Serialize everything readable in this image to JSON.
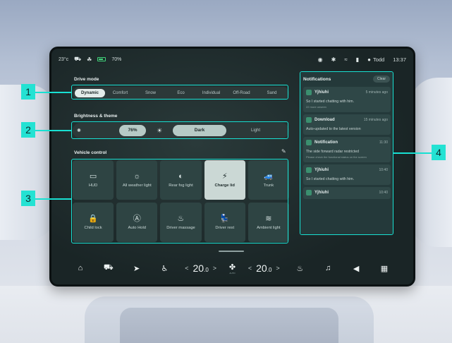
{
  "status_bar": {
    "temperature": "23°c",
    "battery_pct": "70%",
    "user_name": "Todd",
    "time": "13:37"
  },
  "drive_mode": {
    "title": "Drive mode",
    "modes": [
      "Dynamic",
      "Comfort",
      "Snow",
      "Eco",
      "Individual",
      "Off-Road",
      "Sand"
    ],
    "active": "Dynamic"
  },
  "brightness": {
    "title": "Brightness & theme",
    "value": "76%",
    "theme_dark": "Dark",
    "theme_light": "Light",
    "active_theme": "Dark"
  },
  "vehicle_control": {
    "title": "Vehicle control",
    "tiles": [
      {
        "label": "HUD",
        "icon": "hud-icon",
        "glyph": "▭",
        "active": false
      },
      {
        "label": "All weather light",
        "icon": "all-weather-light-icon",
        "glyph": "☼",
        "active": false
      },
      {
        "label": "Rear fog light",
        "icon": "rear-fog-light-icon",
        "glyph": "◐",
        "active": false
      },
      {
        "label": "Charge lid",
        "icon": "charge-lid-icon",
        "glyph": "⚡",
        "active": true
      },
      {
        "label": "Trunk",
        "icon": "trunk-icon",
        "glyph": "🚙",
        "active": false
      },
      {
        "label": "Child lock",
        "icon": "child-lock-icon",
        "glyph": "🔒",
        "active": false
      },
      {
        "label": "Auto Hold",
        "icon": "auto-hold-icon",
        "glyph": "Ⓐ",
        "active": false
      },
      {
        "label": "Driver massage",
        "icon": "driver-massage-icon",
        "glyph": "♨",
        "active": false
      },
      {
        "label": "Driver rest",
        "icon": "driver-rest-icon",
        "glyph": "💺",
        "active": false
      },
      {
        "label": "Ambient light",
        "icon": "ambient-light-icon",
        "glyph": "≋",
        "active": false
      }
    ]
  },
  "notifications": {
    "title": "Notifications",
    "clear_label": "Clear",
    "items": [
      {
        "app": "Yjhiuhi",
        "time": "5 minutes ago",
        "body": "So I started chatting with him.",
        "sub": "22 more unseen"
      },
      {
        "app": "Download",
        "time": "15 minutes ago",
        "body": "Auto-updated to the latest version",
        "sub": ""
      },
      {
        "app": "Notification",
        "time": "11:30",
        "body": "The side forward radar restricted",
        "sub": "Please check the functional status on the screen"
      },
      {
        "app": "Yjhiuhi",
        "time": "10:40",
        "body": "So I started chatting with him.",
        "sub": ""
      },
      {
        "app": "Yjhiuhi",
        "time": "10:40",
        "body": "",
        "sub": ""
      }
    ]
  },
  "dock": {
    "temp_left": "20",
    "temp_left_decimal": ".0",
    "temp_right": "20",
    "temp_right_decimal": ".0",
    "fan_label": "AUTO",
    "icons": [
      "home-icon",
      "car-icon",
      "navigation-icon",
      "seat-icon",
      "fan-icon",
      "seat-heat-icon",
      "music-icon",
      "volume-icon",
      "apps-icon"
    ]
  },
  "callouts": [
    "1",
    "2",
    "3",
    "4"
  ],
  "colors": {
    "accent_cyan": "#24e2d3",
    "tile_bg": "#2e4443",
    "tile_active": "#cbd8d5",
    "screen_bg": "#1a2325"
  }
}
